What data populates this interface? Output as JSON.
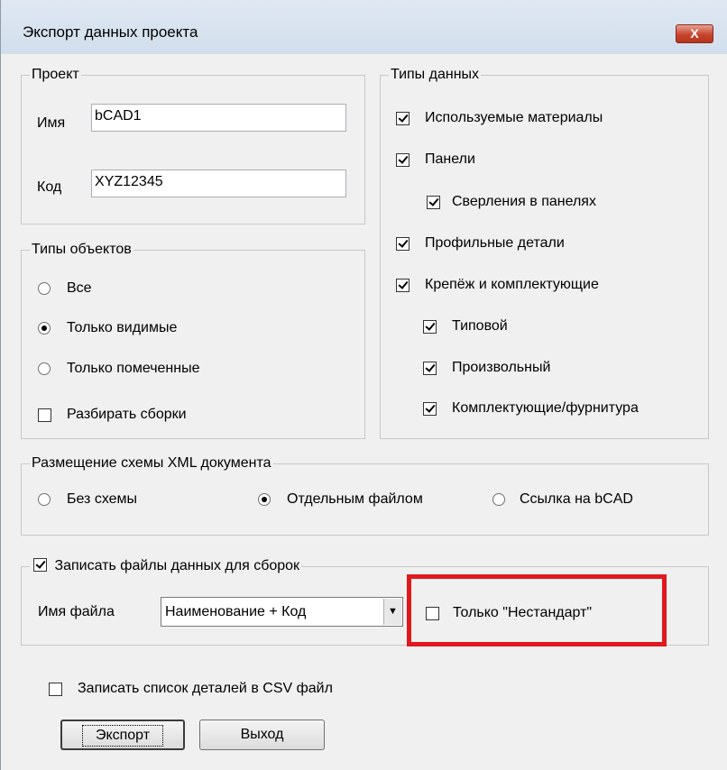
{
  "window": {
    "title": "Экспорт данных проекта",
    "close_label": "X"
  },
  "project": {
    "title": "Проект",
    "name_label": "Имя",
    "name_value": "bCAD1",
    "code_label": "Код",
    "code_value": "XYZ12345"
  },
  "object_types": {
    "title": "Типы объектов",
    "all": "Все",
    "visible_only": "Только видимые",
    "marked_only": "Только помеченные",
    "selected": "visible_only",
    "explode_assemblies": "Разбирать сборки",
    "explode_checked": false
  },
  "data_types": {
    "title": "Типы данных",
    "materials": "Используемые материалы",
    "panels": "Панели",
    "drillings": "Сверления в панелях",
    "profiles": "Профильные детали",
    "fasteners": "Крепёж и комплектующие",
    "typical": "Типовой",
    "arbitrary": "Произвольный",
    "hardware": "Комплектующие/фурнитура",
    "all_checked": true
  },
  "xml_schema": {
    "title": "Размещение схемы XML документа",
    "none": "Без схемы",
    "separate_file": "Отдельным файлом",
    "link_bcad": "Ссылка на bCAD",
    "selected": "separate_file"
  },
  "assembly_files": {
    "title": "Записать файлы данных для сборок",
    "title_checked": true,
    "file_name_label": "Имя файла",
    "file_name_value": "Наименование + Код",
    "non_standard": "Только \"Нестандарт\"",
    "non_standard_checked": false
  },
  "csv": {
    "label": "Записать список деталей в CSV файл",
    "checked": false
  },
  "buttons": {
    "export": "Экспорт",
    "exit": "Выход"
  },
  "colors": {
    "highlight": "#e0191e",
    "close_button": "#c7452e"
  }
}
